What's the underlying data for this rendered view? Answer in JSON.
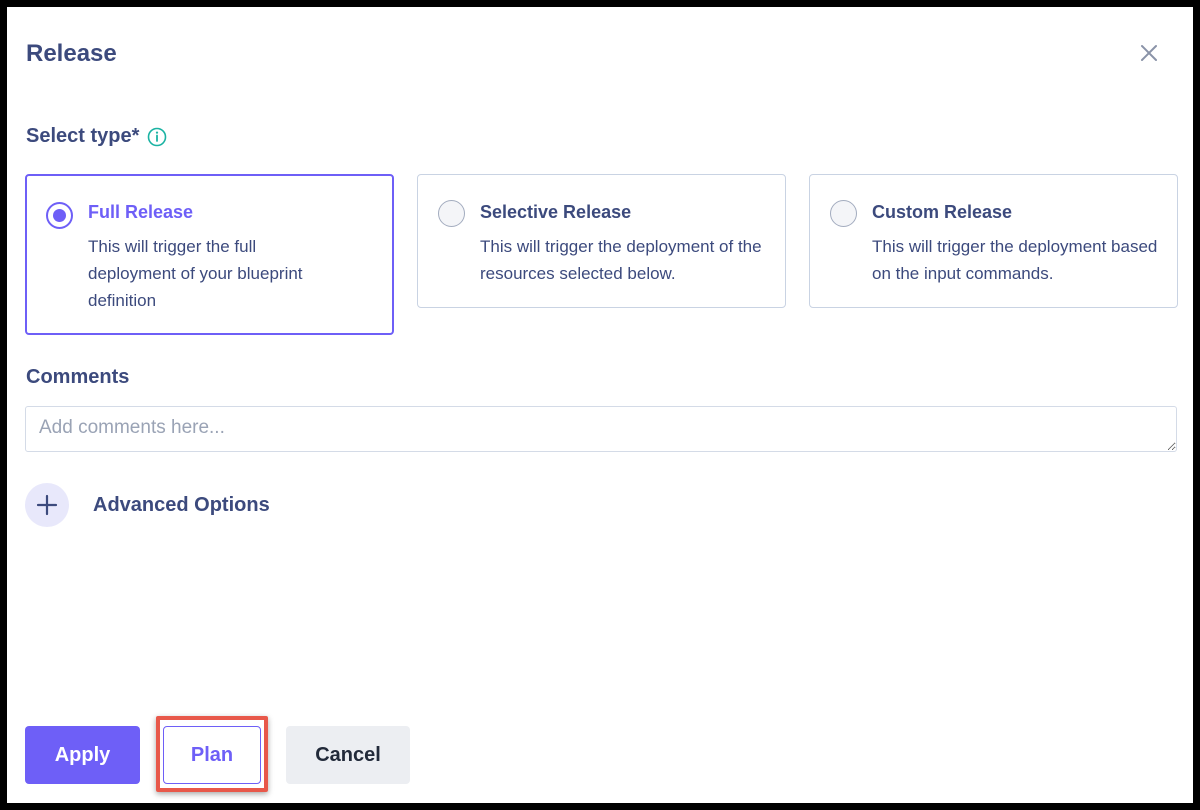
{
  "dialog": {
    "title": "Release",
    "close_icon": "close-icon"
  },
  "type_section": {
    "label": "Select type*",
    "info_icon": "info-icon",
    "options": [
      {
        "title": "Full Release",
        "description": "This will trigger the full deployment of your blueprint definition",
        "selected": true
      },
      {
        "title": "Selective Release",
        "description": "This will trigger the deployment of the resources selected below.",
        "selected": false
      },
      {
        "title": "Custom Release",
        "description": "This will trigger the deployment based on the input commands.",
        "selected": false
      }
    ]
  },
  "comments": {
    "label": "Comments",
    "placeholder": "Add comments here...",
    "value": ""
  },
  "advanced": {
    "label": "Advanced Options",
    "icon": "plus-icon"
  },
  "actions": {
    "apply_label": "Apply",
    "plan_label": "Plan",
    "cancel_label": "Cancel"
  },
  "colors": {
    "accent": "#6e5ff7",
    "text": "#3c4a7d",
    "highlight": "#e8584a",
    "info": "#1bb3a3"
  }
}
